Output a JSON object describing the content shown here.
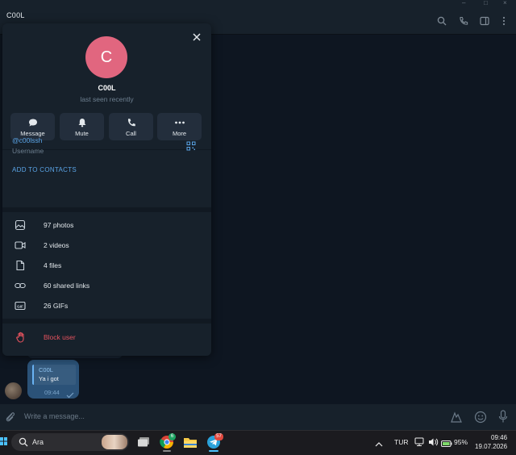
{
  "window": {
    "title": "C00L"
  },
  "profile": {
    "avatar_letter": "C",
    "avatar_color": "#e1667f",
    "name": "C00L",
    "status": "last seen recently",
    "actions": [
      {
        "label": "Message",
        "icon": "chat-bubble-icon"
      },
      {
        "label": "Mute",
        "icon": "bell-icon"
      },
      {
        "label": "Call",
        "icon": "phone-icon"
      },
      {
        "label": "More",
        "icon": "more-dots-icon"
      }
    ],
    "username_value": "@c00lssh",
    "username_label": "Username",
    "add_contacts": "ADD TO CONTACTS",
    "media": [
      {
        "label": "97 photos",
        "icon": "photo-icon"
      },
      {
        "label": "2 videos",
        "icon": "video-icon"
      },
      {
        "label": "4 files",
        "icon": "file-icon"
      },
      {
        "label": "60 shared links",
        "icon": "link-icon"
      },
      {
        "label": "26 GIFs",
        "icon": "gif-icon"
      }
    ],
    "block_label": "Block user"
  },
  "message": {
    "quote_sender": "C00L",
    "quote_text": "Ya i got",
    "time": "09:44"
  },
  "composer": {
    "placeholder": "Write a message..."
  },
  "taskbar": {
    "search_placeholder": "Ara",
    "chrome_badge": "6",
    "telegram_badge": "57",
    "language": "TUR",
    "battery": "95%",
    "time": "09:46",
    "date": "19.07.2026"
  },
  "colors": {
    "accent": "#5aa4e6",
    "danger": "#e5525e",
    "panel": "#17212b",
    "chat_bg": "#0e1621"
  }
}
